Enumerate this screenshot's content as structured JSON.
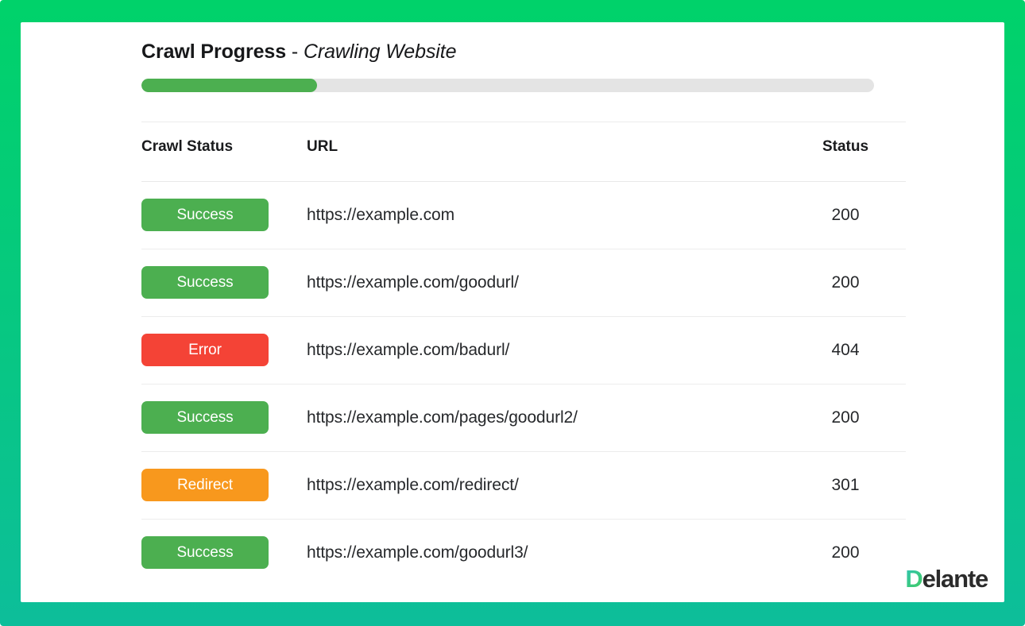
{
  "frame": {
    "gradient_top": "#00d26a",
    "gradient_bottom": "#0dbe9a"
  },
  "header": {
    "title_main": "Crawl Progress",
    "title_separator": " - ",
    "title_sub": "Crawling Website"
  },
  "progress": {
    "percent": 24,
    "fill_color": "#4caf50",
    "track_color": "#e4e4e4"
  },
  "table": {
    "columns": [
      "Crawl Status",
      "URL",
      "Status"
    ],
    "rows": [
      {
        "status": "Success",
        "status_type": "success",
        "url": "https://example.com",
        "code": "200"
      },
      {
        "status": "Success",
        "status_type": "success",
        "url": "https://example.com/goodurl/",
        "code": "200"
      },
      {
        "status": "Error",
        "status_type": "error",
        "url": "https://example.com/badurl/",
        "code": "404"
      },
      {
        "status": "Success",
        "status_type": "success",
        "url": "https://example.com/pages/goodurl2/",
        "code": "200"
      },
      {
        "status": "Redirect",
        "status_type": "redirect",
        "url": "https://example.com/redirect/",
        "code": "301"
      },
      {
        "status": "Success",
        "status_type": "success",
        "url": "https://example.com/goodurl3/",
        "code": "200"
      }
    ],
    "badge_colors": {
      "success": "#4caf50",
      "error": "#f44336",
      "redirect": "#f8981d"
    }
  },
  "logo": {
    "letter_d": "D",
    "rest": "elante"
  }
}
